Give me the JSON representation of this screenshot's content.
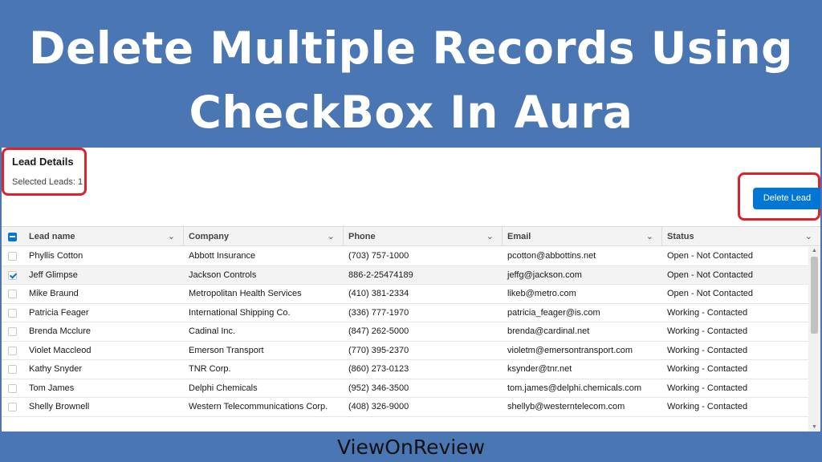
{
  "banner": {
    "line1": "Delete Multiple Records Using",
    "line2": "CheckBox In Aura"
  },
  "card": {
    "title": "Lead Details",
    "selected_text": "Selected Leads: 1",
    "delete_button": "Delete Lead"
  },
  "table": {
    "columns": [
      "Lead name",
      "Company",
      "Phone",
      "Email",
      "Status"
    ],
    "rows": [
      {
        "name": "Phyllis Cotton",
        "company": "Abbott Insurance",
        "phone": "(703) 757-1000",
        "email": "pcotton@abbottins.net",
        "status": "Open - Not Contacted",
        "checked": false
      },
      {
        "name": "Jeff Glimpse",
        "company": "Jackson Controls",
        "phone": "886-2-25474189",
        "email": "jeffg@jackson.com",
        "status": "Open - Not Contacted",
        "checked": true
      },
      {
        "name": "Mike Braund",
        "company": "Metropolitan Health Services",
        "phone": "(410) 381-2334",
        "email": "likeb@metro.com",
        "status": "Open - Not Contacted",
        "checked": false
      },
      {
        "name": "Patricia Feager",
        "company": "International Shipping Co.",
        "phone": "(336) 777-1970",
        "email": "patricia_feager@is.com",
        "status": "Working - Contacted",
        "checked": false
      },
      {
        "name": "Brenda Mcclure",
        "company": "Cadinal Inc.",
        "phone": "(847) 262-5000",
        "email": "brenda@cardinal.net",
        "status": "Working - Contacted",
        "checked": false
      },
      {
        "name": "Violet Maccleod",
        "company": "Emerson Transport",
        "phone": "(770) 395-2370",
        "email": "violetm@emersontransport.com",
        "status": "Working - Contacted",
        "checked": false
      },
      {
        "name": "Kathy Snyder",
        "company": "TNR Corp.",
        "phone": "(860) 273-0123",
        "email": "ksynder@tnr.net",
        "status": "Working - Contacted",
        "checked": false
      },
      {
        "name": "Tom James",
        "company": "Delphi Chemicals",
        "phone": "(952) 346-3500",
        "email": "tom.james@delphi.chemicals.com",
        "status": "Working - Contacted",
        "checked": false
      },
      {
        "name": "Shelly Brownell",
        "company": "Western Telecommunications Corp.",
        "phone": "(408) 326-9000",
        "email": "shellyb@westerntelecom.com",
        "status": "Working - Contacted",
        "checked": false
      }
    ]
  },
  "footer": {
    "brand": "ViewOnReview"
  },
  "colors": {
    "banner_bg": "#4a76b4",
    "button_blue": "#0176d3",
    "highlight_red": "#e0202a"
  }
}
